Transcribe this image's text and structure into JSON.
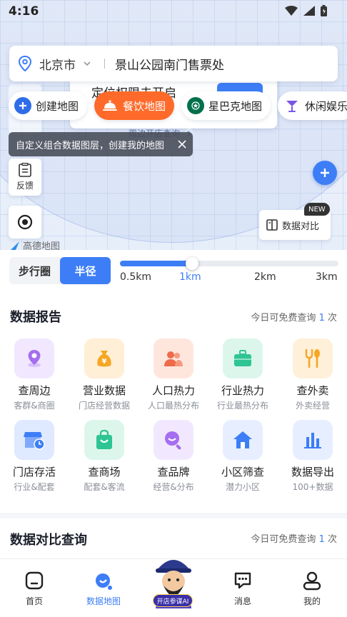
{
  "status_bar": {
    "time": "4:16"
  },
  "search": {
    "city": "北京市",
    "query": "景山公园南门售票处"
  },
  "background_dialog": {
    "title": "定位权限未开启",
    "link": "周边开店查询"
  },
  "map_chips": [
    {
      "label": "创建地图",
      "icon": "plus-circle-icon",
      "color": "#2f6de8"
    },
    {
      "label": "餐饮地图",
      "icon": "cloche-icon",
      "active": true,
      "color": "#ff6a2a"
    },
    {
      "label": "星巴克地图",
      "icon": "starbucks-logo-icon",
      "color": "#00704a"
    },
    {
      "label": "休闲娱乐",
      "icon": "cocktail-icon",
      "color": "#7b55e6"
    }
  ],
  "tooltip": {
    "text": "自定义组合数据图层，创建我的地图"
  },
  "map_controls": {
    "feedback_label": "反馈",
    "compare_label": "数据对比",
    "new_badge": "NEW",
    "map_logo_text": "高德地图"
  },
  "range": {
    "modes": [
      "步行圈",
      "半径"
    ],
    "active_mode": "半径",
    "options": [
      "0.5km",
      "1km",
      "2km",
      "3km"
    ],
    "selected": "1km",
    "selected_fraction": 0.33
  },
  "data_report": {
    "title": "数据报告",
    "free_note_prefix": "今日可免费查询",
    "free_count": "1",
    "free_note_suffix": "次",
    "items": [
      {
        "title": "查周边",
        "subtitle": "客群&商圈",
        "icon": "location-pin-icon",
        "bg": "#f1e8ff",
        "color": "#a56ef0"
      },
      {
        "title": "营业数据",
        "subtitle": "门店经营数据",
        "icon": "money-bag-icon",
        "bg": "#ffefd6",
        "color": "#f5a623"
      },
      {
        "title": "人口热力",
        "subtitle": "人口最热分布",
        "icon": "people-icon",
        "bg": "#ffe6dd",
        "color": "#ef6b4a"
      },
      {
        "title": "行业热力",
        "subtitle": "行业最热分布",
        "icon": "briefcase-icon",
        "bg": "#dcf6ec",
        "color": "#2ec493"
      },
      {
        "title": "查外卖",
        "subtitle": "外卖经营",
        "icon": "fork-spoon-icon",
        "bg": "#fff0d9",
        "color": "#f5a623"
      },
      {
        "title": "门店存活",
        "subtitle": "行业&配套",
        "icon": "store-clock-icon",
        "bg": "#dfe9ff",
        "color": "#3d7ef7"
      },
      {
        "title": "查商场",
        "subtitle": "配套&客流",
        "icon": "shopping-bag-icon",
        "bg": "#dcf6ec",
        "color": "#2ec493"
      },
      {
        "title": "查品牌",
        "subtitle": "经营&分布",
        "icon": "magnifier-icon",
        "bg": "#f1e8ff",
        "color": "#a56ef0"
      },
      {
        "title": "小区筛查",
        "subtitle": "潜力小区",
        "icon": "house-icon",
        "bg": "#e6eeff",
        "color": "#3d7ef7"
      },
      {
        "title": "数据导出",
        "subtitle": "100+数据",
        "icon": "bar-chart-icon",
        "bg": "#e6eeff",
        "color": "#3d7ef7"
      }
    ]
  },
  "data_compare": {
    "title": "数据对比查询",
    "free_note_prefix": "今日可免费查询",
    "free_count": "1",
    "free_note_suffix": "次"
  },
  "bottom_nav": {
    "items": [
      {
        "label": "首页",
        "icon": "home-icon"
      },
      {
        "label": "数据地图",
        "icon": "map-data-icon",
        "active": true
      },
      {
        "label": "开店参谋AI",
        "icon": "mascot-icon"
      },
      {
        "label": "消息",
        "icon": "message-icon"
      },
      {
        "label": "我的",
        "icon": "user-icon"
      }
    ]
  },
  "colors": {
    "accent": "#3d7ef7",
    "orange": "#ff6a2a"
  }
}
